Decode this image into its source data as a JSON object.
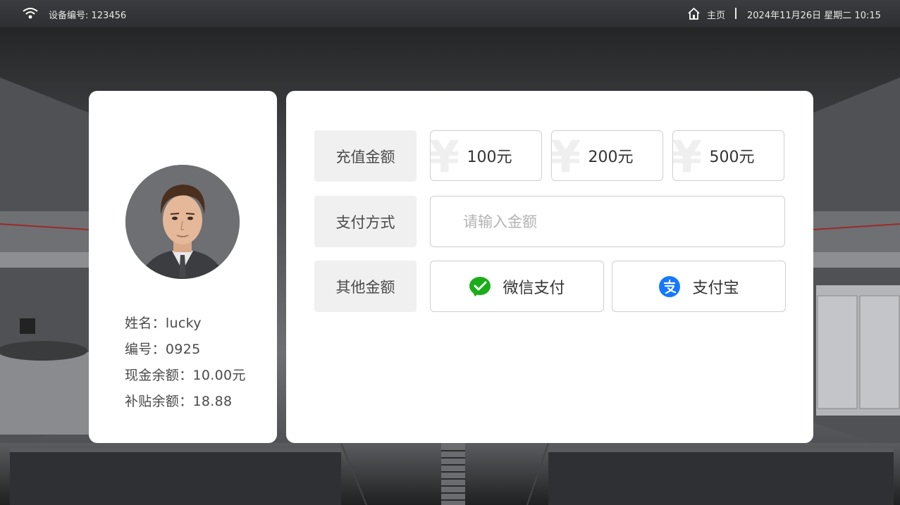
{
  "status_bar": {
    "device_label": "设备编号: 123456",
    "home_label": "主页",
    "datetime": "2024年11月26日 星期二 10:15"
  },
  "profile": {
    "name_label": "姓名：",
    "name_value": "lucky",
    "id_label": "编号：",
    "id_value": "0925",
    "cash_label": "现金余额：",
    "cash_value": "10.00元",
    "subsidy_label": "补贴余额：",
    "subsidy_value": "18.88"
  },
  "payment": {
    "recharge_label": "充值金额",
    "method_label": "支付方式",
    "other_label": "其他金额",
    "currency_symbol": "¥",
    "amounts": [
      "100元",
      "200元",
      "500元"
    ],
    "input_placeholder": "请输入金额",
    "wechat_label": "微信支付",
    "alipay_label": "支付宝"
  },
  "colors": {
    "wechat_green": "#1aad19",
    "alipay_blue": "#1677ff",
    "label_bg": "#f0f0f0"
  }
}
